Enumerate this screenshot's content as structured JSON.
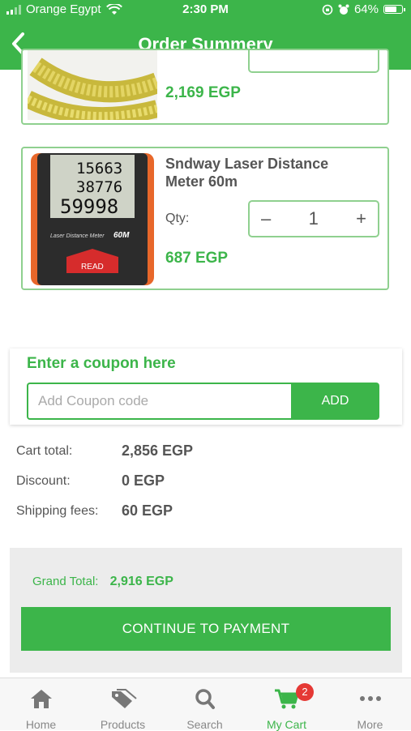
{
  "status_bar": {
    "carrier": "Orange Egypt",
    "time": "2:30 PM",
    "battery": "64%"
  },
  "nav": {
    "title": "Order Summery"
  },
  "products": [
    {
      "name": "",
      "price": "2,169 EGP"
    },
    {
      "name": "Sndway Laser Distance Meter 60m",
      "qty_label": "Qty:",
      "qty": "1",
      "price": "687 EGP",
      "image_readings": [
        "15663",
        "38776",
        "59998"
      ],
      "image_badge": "60M",
      "image_button": "READ",
      "image_caption": "Laser Distance Meter"
    }
  ],
  "coupon": {
    "title": "Enter a coupon here",
    "placeholder": "Add Coupon code",
    "value": "",
    "button_label": "ADD"
  },
  "totals": {
    "cart_total_label": "Cart total:",
    "cart_total_value": "2,856 EGP",
    "discount_label": "Discount:",
    "discount_value": "0 EGP",
    "shipping_label": "Shipping fees:",
    "shipping_value": "60 EGP"
  },
  "grand": {
    "label": "Grand Total:",
    "value": "2,916 EGP",
    "button_label": "CONTINUE TO PAYMENT"
  },
  "tabs": [
    {
      "label": "Home",
      "icon": "home-icon"
    },
    {
      "label": "Products",
      "icon": "tag-icon"
    },
    {
      "label": "Search",
      "icon": "search-icon"
    },
    {
      "label": "My Cart",
      "icon": "cart-icon",
      "badge": "2",
      "active": true
    },
    {
      "label": "More",
      "icon": "more-icon"
    }
  ],
  "colors": {
    "brand_green": "#3cb54a",
    "badge_red": "#e53935"
  }
}
